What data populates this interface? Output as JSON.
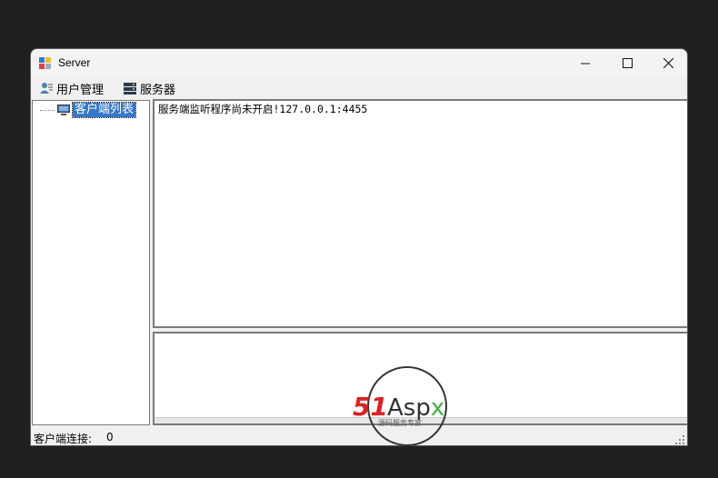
{
  "window": {
    "title": "Server"
  },
  "titlebar": {
    "buttons": [
      "minimize",
      "maximize",
      "close"
    ]
  },
  "menu": {
    "items": [
      {
        "label": "用户管理",
        "icon": "user-manage-icon"
      },
      {
        "label": "服务器",
        "icon": "server-icon"
      }
    ]
  },
  "tree": {
    "root_label": "客户端列表",
    "root_icon": "computer-icon"
  },
  "log": {
    "text": "服务端监听程序尚未开启!127.0.0.1:4455"
  },
  "input": {
    "value": ""
  },
  "status": {
    "label": "客户端连接:",
    "value": "0"
  },
  "watermark": {
    "brand": "51Aspx",
    "tagline": "源码服务专家"
  },
  "colors": {
    "selection": "#3478c7",
    "background": "#202020",
    "watermark_red": "#e02020",
    "watermark_green": "#3cb043"
  }
}
